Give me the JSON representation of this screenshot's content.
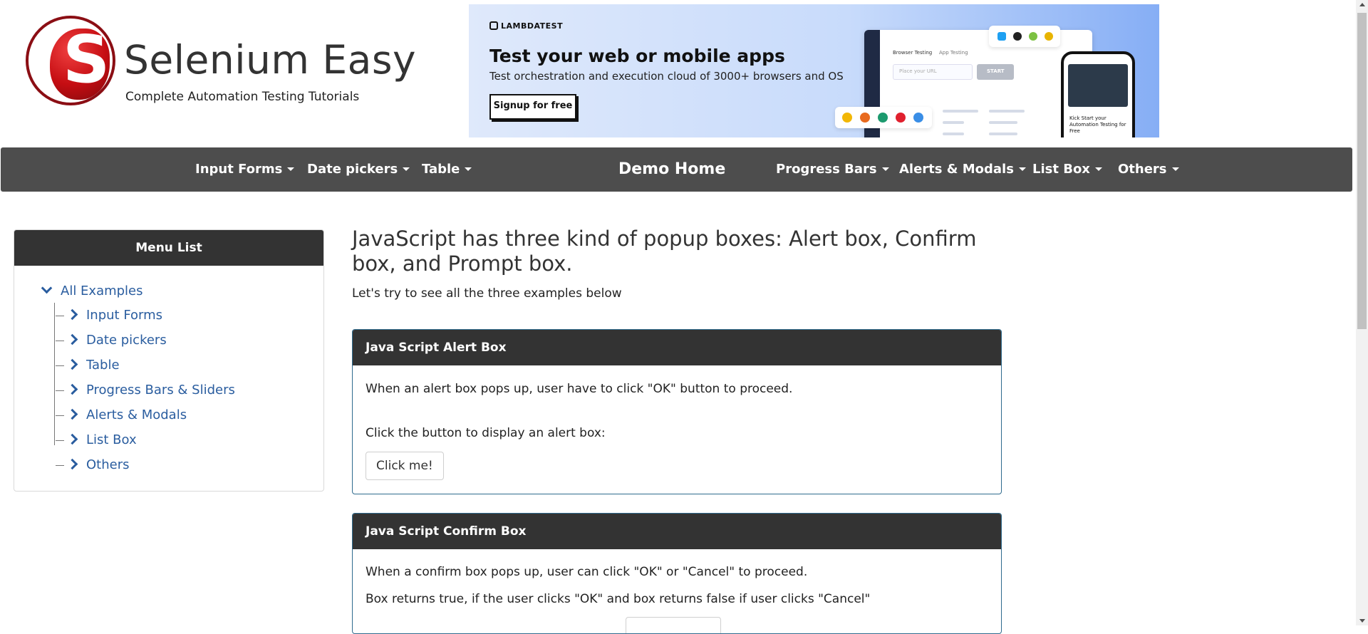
{
  "brand": {
    "title": "Selenium Easy",
    "subtitle": "Complete Automation Testing Tutorials",
    "logo_letter": "S"
  },
  "banner": {
    "logo_text": "LAMBDATEST",
    "title": "Test your web or mobile apps",
    "subtitle": "Test orchestration and execution cloud of 3000+ browsers and OS",
    "cta": "Signup for free",
    "mock_tab_1": "Browser Testing",
    "mock_tab_2": "App Testing",
    "mock_input": "Place your URL",
    "mock_start": "START",
    "phone_text": "Kick Start your Automation Testing for Free"
  },
  "nav": {
    "items": [
      {
        "label": "Input Forms"
      },
      {
        "label": "Date pickers"
      },
      {
        "label": "Table"
      },
      {
        "label": "Demo Home"
      },
      {
        "label": "Progress Bars"
      },
      {
        "label": "Alerts & Modals"
      },
      {
        "label": "List Box"
      },
      {
        "label": "Others"
      }
    ]
  },
  "sidebar": {
    "header": "Menu List",
    "root": "All Examples",
    "items": [
      {
        "label": "Input Forms"
      },
      {
        "label": "Date pickers"
      },
      {
        "label": "Table"
      },
      {
        "label": "Progress Bars & Sliders"
      },
      {
        "label": "Alerts & Modals"
      },
      {
        "label": "List Box"
      },
      {
        "label": "Others"
      }
    ]
  },
  "main": {
    "heading": "JavaScript has three kind of popup boxes: Alert box, Confirm box, and Prompt box.",
    "subheading": "Let's try to see all the three examples below",
    "alert_card": {
      "title": "Java Script Alert Box",
      "description": "When an alert box pops up, user have to click \"OK\" button to proceed.",
      "instruction": "Click the button to display an alert box:",
      "button": "Click me!"
    },
    "confirm_card": {
      "title": "Java Script Confirm Box",
      "description": "When a confirm box pops up, user can click \"OK\" or \"Cancel\" to proceed.",
      "detail": "Box returns true, if the user clicks \"OK\" and box returns false if user clicks \"Cancel\""
    }
  },
  "colors": {
    "navbar": "#4d4d4d",
    "panel_header": "#333333",
    "link": "#2a5d9f",
    "card_border": "#2f6b8e"
  }
}
